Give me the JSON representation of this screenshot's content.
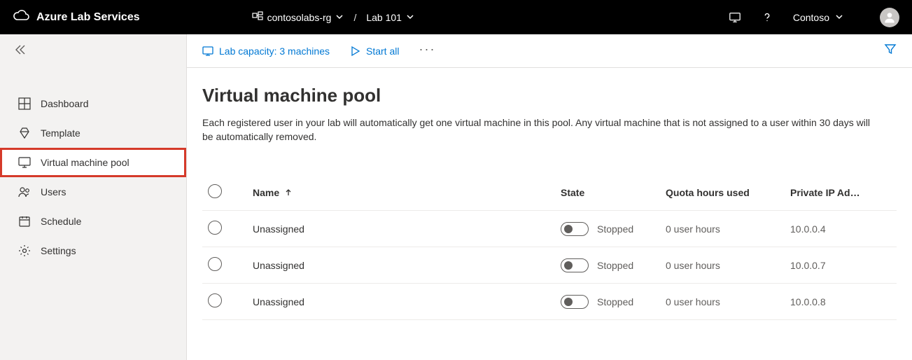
{
  "header": {
    "product": "Azure Lab Services",
    "breadcrumb": {
      "rg": "contosolabs-rg",
      "lab": "Lab 101"
    },
    "user": "Contoso"
  },
  "sidebar": {
    "items": [
      {
        "label": "Dashboard"
      },
      {
        "label": "Template"
      },
      {
        "label": "Virtual machine pool"
      },
      {
        "label": "Users"
      },
      {
        "label": "Schedule"
      },
      {
        "label": "Settings"
      }
    ]
  },
  "toolbar": {
    "capacity": "Lab capacity: 3 machines",
    "start_all": "Start all"
  },
  "page": {
    "title": "Virtual machine pool",
    "description": "Each registered user in your lab will automatically get one virtual machine in this pool. Any virtual machine that is not assigned to a user within 30 days will be automatically removed."
  },
  "table": {
    "columns": {
      "name": "Name",
      "state": "State",
      "quota": "Quota hours used",
      "ip": "Private IP Ad…"
    },
    "rows": [
      {
        "name": "Unassigned",
        "state": "Stopped",
        "quota": "0 user hours",
        "ip": "10.0.0.4"
      },
      {
        "name": "Unassigned",
        "state": "Stopped",
        "quota": "0 user hours",
        "ip": "10.0.0.7"
      },
      {
        "name": "Unassigned",
        "state": "Stopped",
        "quota": "0 user hours",
        "ip": "10.0.0.8"
      }
    ]
  }
}
